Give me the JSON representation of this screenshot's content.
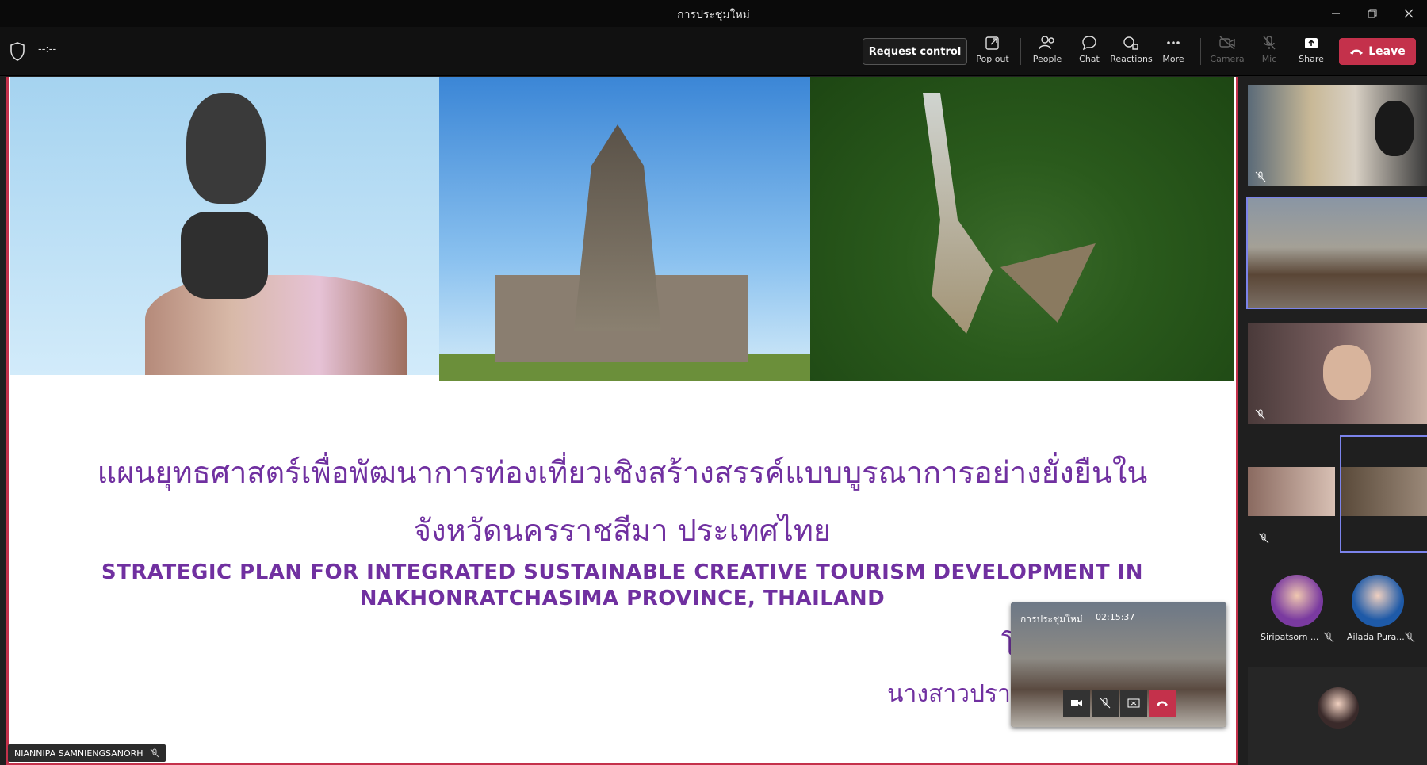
{
  "window": {
    "title": "การประชุมใหม่"
  },
  "toolbar": {
    "timer": "--:--",
    "request_control": "Request control",
    "pop_out": "Pop out",
    "people": "People",
    "chat": "Chat",
    "reactions": "Reactions",
    "more": "More",
    "camera": "Camera",
    "mic": "Mic",
    "share": "Share",
    "leave": "Leave"
  },
  "slide": {
    "title_th_line1": "แผนยุทธศาสตร์เพื่อพัฒนาการท่องเที่ยวเชิงสร้างสรรค์แบบบูรณาการอย่างยั่งยืนใน",
    "title_th_line2": "จังหวัดนครราชสีมา ประเทศไทย",
    "title_en_line1": "STRATEGIC PLAN FOR INTEGRATED SUSTAINABLE CREATIVE TOURISM DEVELOPMENT IN",
    "title_en_line2": "NAKHONRATCHASIMA  PROVINCE, THAILAND",
    "partial_char": "โ",
    "partial_author": "นางสาวปรา"
  },
  "presenter": {
    "name": "NIANNIPA SAMNIENGSANORH"
  },
  "mini_window": {
    "title": "การประชุมใหม่",
    "time": "02:15:37"
  },
  "participants": [
    {
      "name": "Siripatsorn ..."
    },
    {
      "name": "Ailada Pura..."
    }
  ],
  "colors": {
    "accent": "#7030a0",
    "leave": "#c4314b",
    "active_tile": "#7b83eb"
  }
}
